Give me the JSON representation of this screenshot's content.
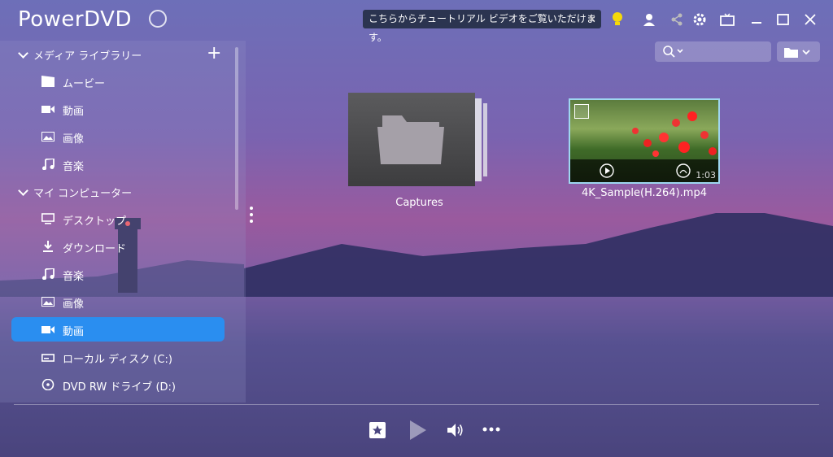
{
  "app": {
    "title": "PowerDVD"
  },
  "tooltip": {
    "text": "こちらからチュートリアル ビデオをご覧いただけます。",
    "close": "×"
  },
  "sidebar": {
    "media_library": {
      "header": "メディア ライブラリー",
      "add": "+",
      "items": [
        {
          "label": "ムービー",
          "icon": "movie-icon"
        },
        {
          "label": "動画",
          "icon": "video-camera-icon"
        },
        {
          "label": "画像",
          "icon": "image-icon"
        },
        {
          "label": "音楽",
          "icon": "music-note-icon"
        }
      ]
    },
    "my_computer": {
      "header": "マイ コンピューター",
      "items": [
        {
          "label": "デスクトップ",
          "icon": "monitor-icon"
        },
        {
          "label": "ダウンロード",
          "icon": "download-icon"
        },
        {
          "label": "音楽",
          "icon": "music-note-icon"
        },
        {
          "label": "画像",
          "icon": "image-icon"
        },
        {
          "label": "動画",
          "icon": "video-camera-icon",
          "active": true
        },
        {
          "label": "ローカル ディスク (C:)",
          "icon": "drive-icon"
        },
        {
          "label": "DVD RW ドライブ (D:)",
          "icon": "disc-icon"
        }
      ]
    }
  },
  "content": {
    "folder": {
      "label": "Captures"
    },
    "video": {
      "label": "4K_Sample(H.264).mp4",
      "duration": "1:03"
    }
  },
  "colors": {
    "accent": "#2a8ef0",
    "tooltip_bg": "#2b3450",
    "bulb": "#f5d90a"
  }
}
